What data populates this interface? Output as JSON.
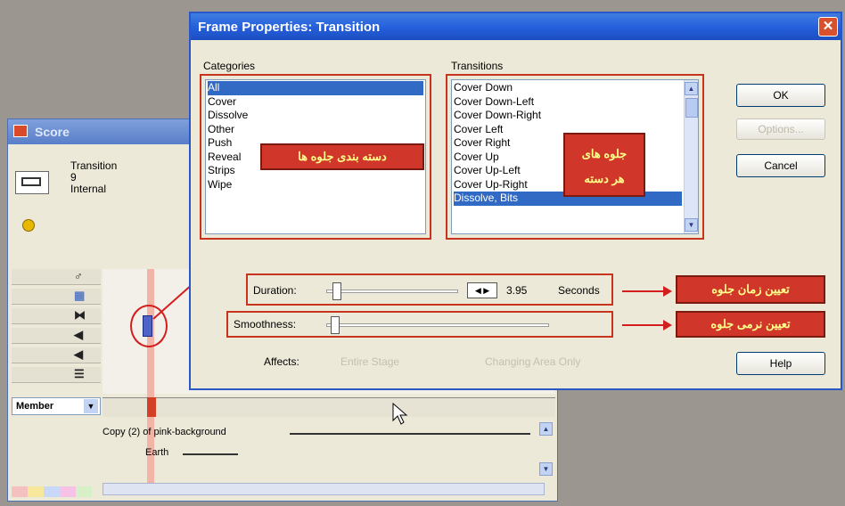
{
  "dialog": {
    "title": "Frame Properties: Transition",
    "close_glyph": "✕",
    "categories_label": "Categories",
    "categories": [
      "All",
      "Cover",
      "Dissolve",
      "Other",
      "Push",
      "Reveal",
      "Strips",
      "Wipe"
    ],
    "categories_selected": "All",
    "transitions_label": "Transitions",
    "transitions": [
      "Cover Down",
      "Cover Down-Left",
      "Cover Down-Right",
      "Cover Left",
      "Cover Right",
      "Cover Up",
      "Cover Up-Left",
      "Cover Up-Right",
      "Dissolve, Bits"
    ],
    "transitions_selected": "Dissolve, Bits",
    "buttons": {
      "ok": "OK",
      "options": "Options...",
      "cancel": "Cancel",
      "help": "Help"
    },
    "duration_label": "Duration:",
    "duration_value": "3.95",
    "duration_unit": "Seconds",
    "duration_level": 0.05,
    "smoothness_label": "Smoothness:",
    "smoothness_level": 0.02,
    "affects_label": "Affects:",
    "affects_options": [
      "Entire Stage",
      "Changing Area Only"
    ]
  },
  "annotations": {
    "categories_note": "دسته بندی جلوه ها",
    "transitions_note_line1": "جلوه های",
    "transitions_note_line2": "هر دسته",
    "duration_note": "تعیین زمان جلوه",
    "smoothness_note": "تعیین نرمی جلوه"
  },
  "score": {
    "title": "Score",
    "info_line1": "Transition",
    "info_line2": "9",
    "info_line3": "Internal",
    "member_label": "Member",
    "track1": "Copy (2) of pink-background",
    "track2": "Earth"
  },
  "colors": {
    "accent_red": "#d0362a",
    "title_blue": "#245edb",
    "selection_blue": "#316ac5"
  }
}
